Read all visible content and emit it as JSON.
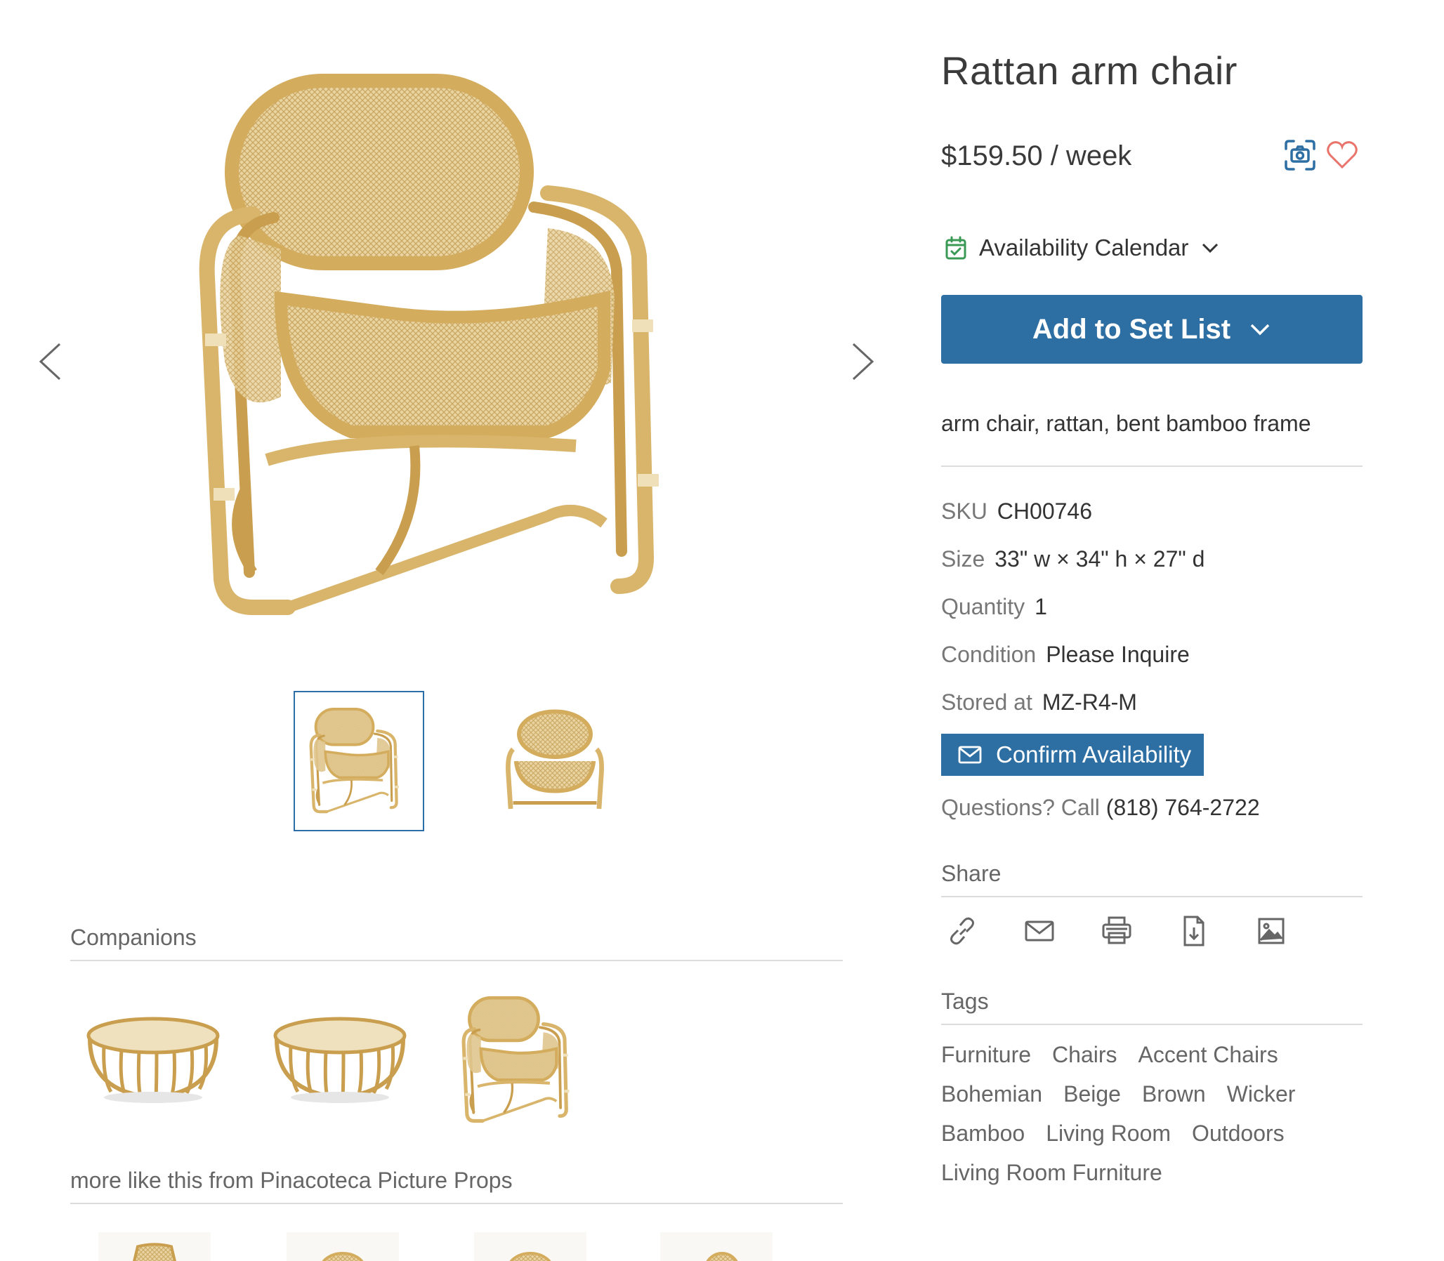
{
  "product": {
    "title": "Rattan arm chair",
    "price": "$159.50 / week",
    "availability_label": "Availability Calendar",
    "add_button_label": "Add to Set List",
    "description": "arm chair, rattan, bent bamboo frame",
    "attributes": [
      {
        "key": "SKU",
        "value": "CH00746"
      },
      {
        "key": "Size",
        "value": "33\" w × 34\" h × 27\" d"
      },
      {
        "key": "Quantity",
        "value": "1"
      },
      {
        "key": "Condition",
        "value": "Please Inquire"
      },
      {
        "key": "Stored at",
        "value": "MZ-R4-M"
      }
    ],
    "confirm_button_label": "Confirm Availability",
    "questions_label": "Questions? Call",
    "phone": "(818) 764-2722"
  },
  "share": {
    "title": "Share",
    "icons": [
      "link-icon",
      "email-icon",
      "print-icon",
      "download-pdf-icon",
      "image-icon"
    ]
  },
  "tags": {
    "title": "Tags",
    "items": [
      "Furniture",
      "Chairs",
      "Accent Chairs",
      "Bohemian",
      "Beige",
      "Brown",
      "Wicker",
      "Bamboo",
      "Living Room",
      "Outdoors",
      "Living Room Furniture"
    ]
  },
  "gallery": {
    "companions_title": "Companions",
    "more_title": "more like this from Pinacoteca Picture Props"
  },
  "colors": {
    "primary": "#2e6fa3",
    "rattan": "#d9b56c",
    "rattan_dark": "#b88d3f",
    "heart": "#e8746c",
    "calendar": "#3a9a55"
  }
}
